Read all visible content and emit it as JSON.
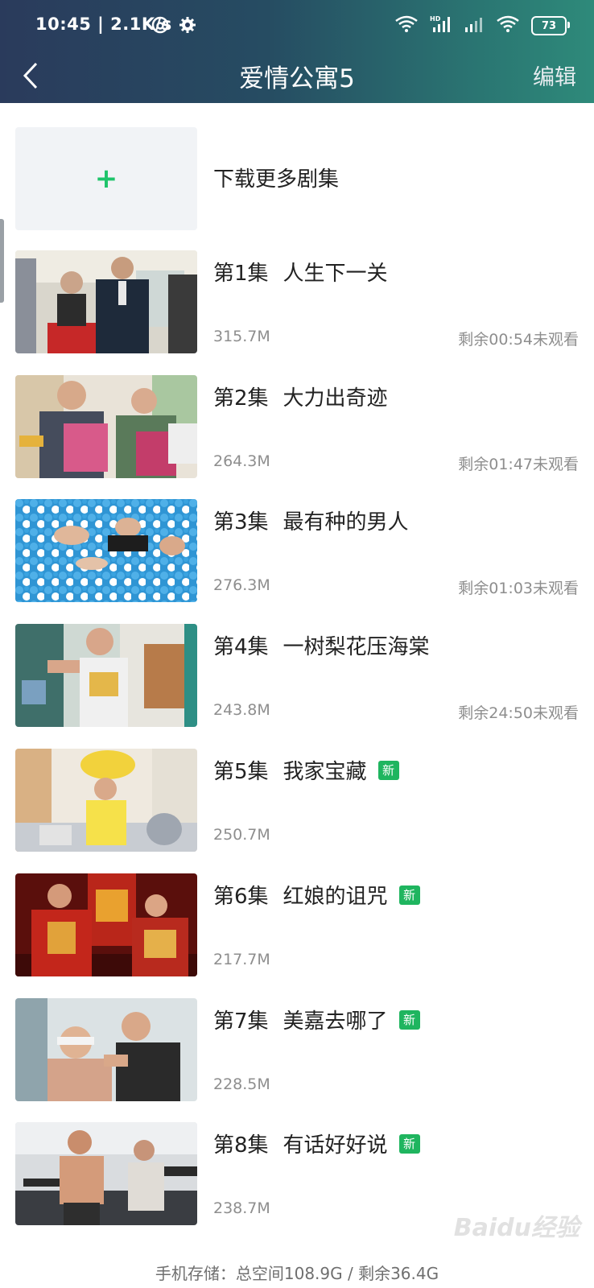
{
  "status_bar": {
    "time": "10:45 | 2.1K/s",
    "battery": "73"
  },
  "header": {
    "title": "爱情公寓5",
    "edit_label": "编辑"
  },
  "download_more": {
    "label": "下载更多剧集"
  },
  "episodes": [
    {
      "num": "第1集",
      "name": "人生下一关",
      "size": "315.7M",
      "remaining": "剩余00:54未观看",
      "is_new": false
    },
    {
      "num": "第2集",
      "name": "大力出奇迹",
      "size": "264.3M",
      "remaining": "剩余01:47未观看",
      "is_new": false
    },
    {
      "num": "第3集",
      "name": "最有种的男人",
      "size": "276.3M",
      "remaining": "剩余01:03未观看",
      "is_new": false
    },
    {
      "num": "第4集",
      "name": "一树梨花压海棠",
      "size": "243.8M",
      "remaining": "剩余24:50未观看",
      "is_new": false
    },
    {
      "num": "第5集",
      "name": "我家宝藏",
      "size": "250.7M",
      "remaining": "",
      "is_new": true
    },
    {
      "num": "第6集",
      "name": "红娘的诅咒",
      "size": "217.7M",
      "remaining": "",
      "is_new": true
    },
    {
      "num": "第7集",
      "name": "美嘉去哪了",
      "size": "228.5M",
      "remaining": "",
      "is_new": true
    },
    {
      "num": "第8集",
      "name": "有话好好说",
      "size": "238.7M",
      "remaining": "",
      "is_new": true
    }
  ],
  "new_badge_label": "新",
  "storage_text": "手机存储：总空间108.9G / 剩余36.4G",
  "watermark_text": "Baidu经验",
  "colors": {
    "accent_green": "#1fb55f",
    "header_start": "#2a3b5c",
    "header_end": "#2e8a7a"
  }
}
